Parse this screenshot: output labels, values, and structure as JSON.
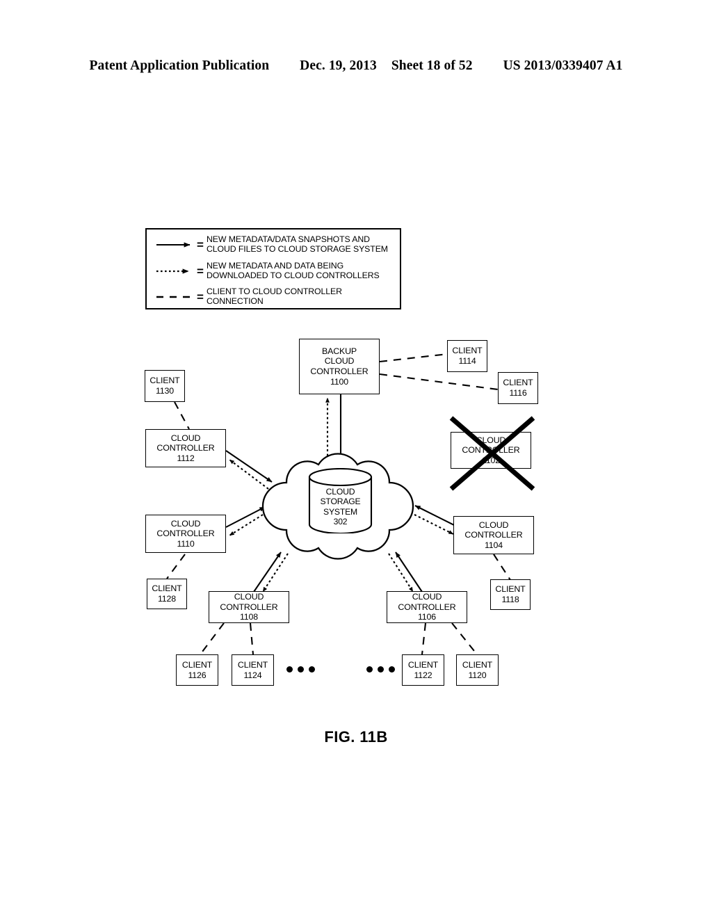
{
  "header": {
    "publication": "Patent Application Publication",
    "date": "Dec. 19, 2013",
    "sheet": "Sheet 18 of 52",
    "patent_number": "US 2013/0339407 A1"
  },
  "legend": {
    "rows": [
      {
        "symbol": "solid-arrow",
        "equals": "=",
        "text": "NEW METADATA/DATA SNAPSHOTS AND\nCLOUD FILES TO CLOUD STORAGE SYSTEM"
      },
      {
        "symbol": "dotted-arrow",
        "equals": "=",
        "text": "NEW METADATA AND DATA BEING\nDOWNLOADED TO CLOUD CONTROLLERS"
      },
      {
        "symbol": "dashed-line",
        "equals": "=",
        "text": "CLIENT TO CLOUD CONTROLLER\nCONNECTION"
      }
    ]
  },
  "diagram": {
    "nodes": {
      "backup_cloud_controller_1100": {
        "lines": [
          "BACKUP",
          "CLOUD",
          "CONTROLLER",
          "1100"
        ]
      },
      "client_1130": {
        "lines": [
          "CLIENT",
          "1130"
        ]
      },
      "client_1114": {
        "lines": [
          "CLIENT",
          "1114"
        ]
      },
      "client_1116": {
        "lines": [
          "CLIENT",
          "1116"
        ]
      },
      "cloud_controller_1102": {
        "lines": [
          "CLOUD",
          "CONTROLLER",
          "1102"
        ],
        "state": "crossed-out"
      },
      "cloud_controller_1112": {
        "lines": [
          "CLOUD",
          "CONTROLLER",
          "1112"
        ]
      },
      "cloud_controller_1110": {
        "lines": [
          "CLOUD",
          "CONTROLLER",
          "1110"
        ]
      },
      "cloud_controller_1104": {
        "lines": [
          "CLOUD",
          "CONTROLLER",
          "1104"
        ]
      },
      "cloud_controller_1108": {
        "lines": [
          "CLOUD",
          "CONTROLLER",
          "1108"
        ]
      },
      "cloud_controller_1106": {
        "lines": [
          "CLOUD",
          "CONTROLLER",
          "1106"
        ]
      },
      "client_1128": {
        "lines": [
          "CLIENT",
          "1128"
        ]
      },
      "client_1126": {
        "lines": [
          "CLIENT",
          "1126"
        ]
      },
      "client_1124": {
        "lines": [
          "CLIENT",
          "1124"
        ]
      },
      "client_1122": {
        "lines": [
          "CLIENT",
          "1122"
        ]
      },
      "client_1120": {
        "lines": [
          "CLIENT",
          "1120"
        ]
      },
      "client_1118": {
        "lines": [
          "CLIENT",
          "1118"
        ]
      },
      "cloud_storage_system_302": {
        "lines": [
          "CLOUD",
          "STORAGE",
          "SYSTEM",
          "302"
        ]
      }
    }
  },
  "figure": {
    "caption": "FIG. 11B"
  }
}
